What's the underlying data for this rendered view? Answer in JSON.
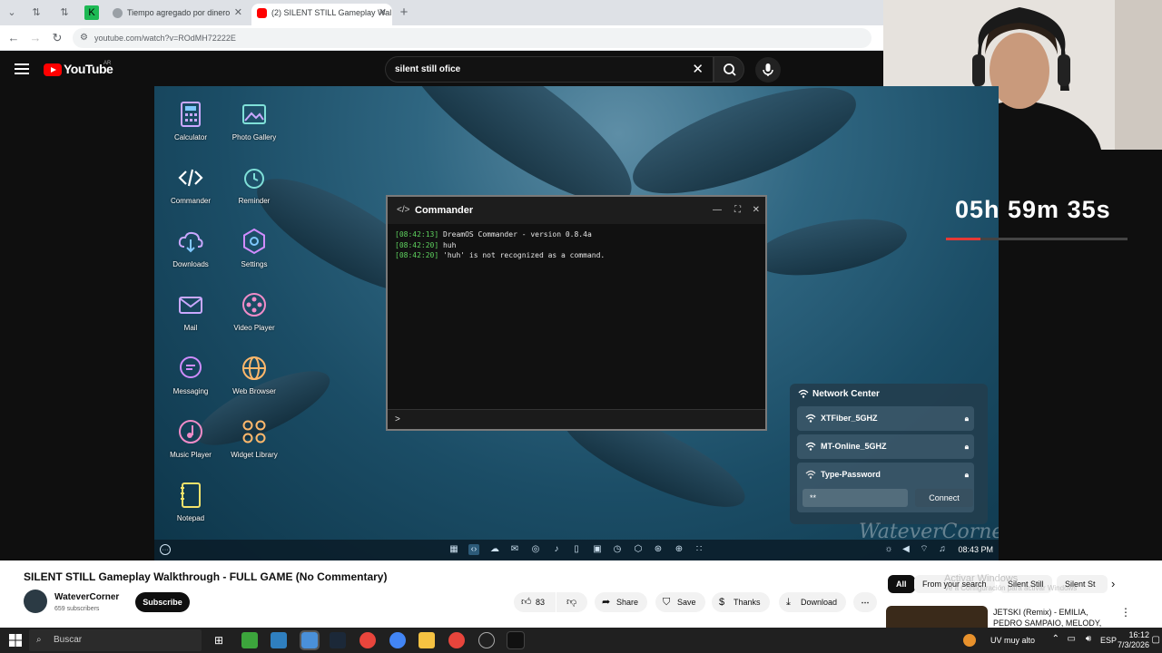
{
  "browser": {
    "tabs": [
      {
        "title": "Tiempo agregado por dinero",
        "active": false
      },
      {
        "title": "(2) SILENT STILL Gameplay Wal",
        "active": true
      }
    ],
    "url": "youtube.com/watch?v=ROdMH72222E"
  },
  "youtube": {
    "logo": "YouTube",
    "country": "AR",
    "search_value": "silent still ofice"
  },
  "game": {
    "apps": [
      {
        "label": "Calculator",
        "icon": "calculator-icon"
      },
      {
        "label": "Photo Gallery",
        "icon": "photo-gallery-icon"
      },
      {
        "label": "Commander",
        "icon": "code-icon"
      },
      {
        "label": "Reminder",
        "icon": "alarm-icon"
      },
      {
        "label": "Downloads",
        "icon": "cloud-download-icon"
      },
      {
        "label": "Settings",
        "icon": "gear-icon"
      },
      {
        "label": "Mail",
        "icon": "mail-icon"
      },
      {
        "label": "Video Player",
        "icon": "video-icon"
      },
      {
        "label": "Messaging",
        "icon": "chat-icon"
      },
      {
        "label": "Web Browser",
        "icon": "globe-icon"
      },
      {
        "label": "Music Player",
        "icon": "music-icon"
      },
      {
        "label": "Widget Library",
        "icon": "widgets-icon"
      },
      {
        "label": "Notepad",
        "icon": "notepad-icon"
      }
    ],
    "commander": {
      "title": "Commander",
      "lines": [
        {
          "time": "[08:42:13]",
          "text": "DreamOS Commander - version 0.8.4a"
        },
        {
          "time": "[08:42:20]",
          "text": "huh"
        },
        {
          "time": "[08:42:20]",
          "text": "'huh' is not recognized as a command."
        }
      ],
      "prompt": ">"
    },
    "network_center": {
      "title": "Network Center",
      "networks": [
        "XTFiber_5GHZ",
        "MT-Online_5GHZ"
      ],
      "password_label": "Type-Password",
      "password_value": "**",
      "connect_label": "Connect"
    },
    "clock": "08:43 PM",
    "watermark": "WateverCorner"
  },
  "stream": {
    "timer": "05h 59m 35s",
    "timer_progress": 0.19
  },
  "video": {
    "title": "SILENT STILL Gameplay Walkthrough - FULL GAME (No Commentary)",
    "channel": "WateverCorner",
    "subscribers": "659 subscribers",
    "subscribe_label": "Subscribe",
    "likes": "83",
    "share_label": "Share",
    "save_label": "Save",
    "thanks_label": "Thanks",
    "download_label": "Download"
  },
  "sidebar": {
    "chips": [
      "All",
      "From your search",
      "Silent Still",
      "Silent St"
    ],
    "activate_windows": "Activar Windows",
    "activate_windows_sub": "Ve a Configuración para activar Windows",
    "recommendation": "JETSKI (Remix) - EMILIA, PEDRO SAMPAIO, MELODY, M..."
  },
  "windows": {
    "search_placeholder": "Buscar",
    "weather": "UV muy alto",
    "language": "ESP",
    "time": "16:12",
    "date": "7/3/2026"
  },
  "colors": {
    "youtube_red": "#ff0000",
    "terminal_green": "#5fd35f",
    "timer_red": "#e53935"
  }
}
